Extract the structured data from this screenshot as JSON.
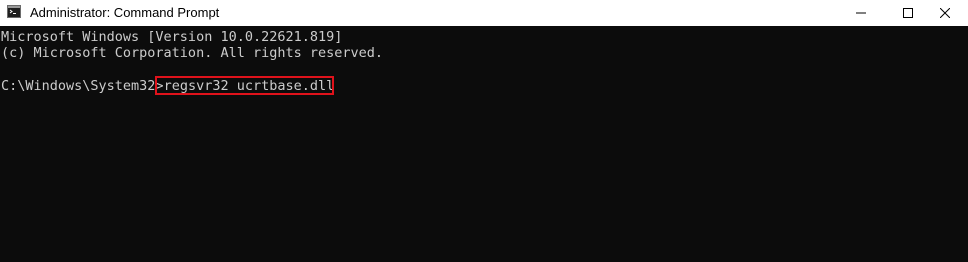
{
  "window": {
    "title": "Administrator: Command Prompt",
    "icon": "cmd-app-icon"
  },
  "caption_buttons": {
    "minimize_icon": "minimize-icon",
    "maximize_icon": "maximize-icon",
    "close_icon": "close-icon"
  },
  "console": {
    "line1": "Microsoft Windows [Version 10.0.22621.819]",
    "line2": "(c) Microsoft Corporation. All rights reserved.",
    "prompt": "C:\\Windows\\System32>",
    "command": "regsvr32 ucrtbase.dll"
  },
  "colors": {
    "console_bg": "#0c0c0c",
    "console_text": "#cccccc",
    "highlight_border": "#e0121b",
    "titlebar_bg": "#ffffff"
  }
}
